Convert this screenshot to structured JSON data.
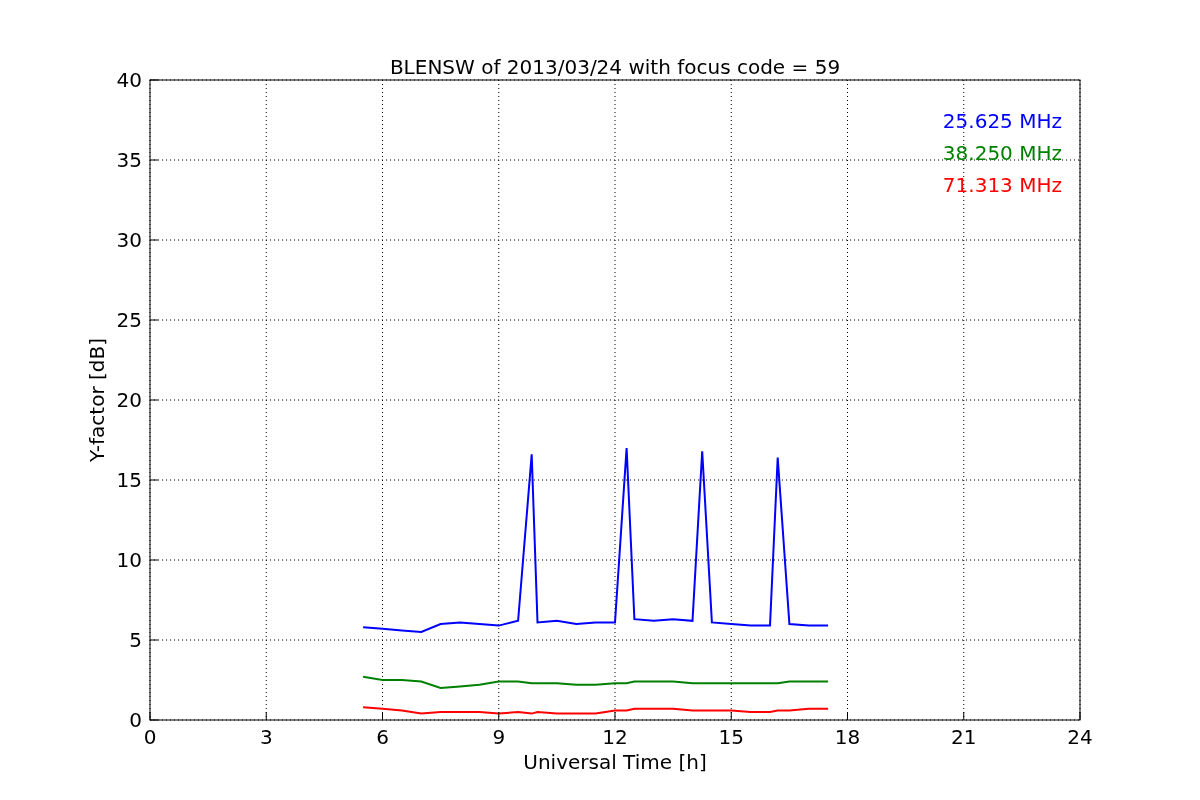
{
  "chart_data": {
    "type": "line",
    "title": "BLENSW of 2013/03/24 with focus code = 59",
    "xlabel": "Universal Time [h]",
    "ylabel": "Y-factor [dB]",
    "x": [
      5.5,
      6,
      6.5,
      7,
      7.5,
      8,
      8.5,
      9,
      9.5,
      9.85,
      10,
      10.5,
      11,
      11.5,
      12,
      12.3,
      12.5,
      13,
      13.5,
      14,
      14.25,
      14.5,
      15,
      15.5,
      16,
      16.2,
      16.5,
      17,
      17.5
    ],
    "series": [
      {
        "name": "25.625 MHz",
        "color": "#0000ff",
        "values": [
          5.8,
          5.7,
          5.6,
          5.5,
          6.0,
          6.1,
          6.0,
          5.9,
          6.2,
          16.6,
          6.1,
          6.2,
          6.0,
          6.1,
          6.1,
          17.0,
          6.3,
          6.2,
          6.3,
          6.2,
          16.8,
          6.1,
          6.0,
          5.9,
          5.9,
          16.4,
          6.0,
          5.9,
          5.9
        ]
      },
      {
        "name": "38.250 MHz",
        "color": "#008000",
        "values": [
          2.7,
          2.5,
          2.5,
          2.4,
          2.0,
          2.1,
          2.2,
          2.4,
          2.4,
          2.3,
          2.3,
          2.3,
          2.2,
          2.2,
          2.3,
          2.3,
          2.4,
          2.4,
          2.4,
          2.3,
          2.3,
          2.3,
          2.3,
          2.3,
          2.3,
          2.3,
          2.4,
          2.4,
          2.4
        ]
      },
      {
        "name": "71.313 MHz",
        "color": "#ff0000",
        "values": [
          0.8,
          0.7,
          0.6,
          0.4,
          0.5,
          0.5,
          0.5,
          0.4,
          0.5,
          0.4,
          0.5,
          0.4,
          0.4,
          0.4,
          0.6,
          0.6,
          0.7,
          0.7,
          0.7,
          0.6,
          0.6,
          0.6,
          0.6,
          0.5,
          0.5,
          0.6,
          0.6,
          0.7,
          0.7
        ]
      }
    ],
    "xlim": [
      0,
      24
    ],
    "ylim": [
      0,
      40
    ],
    "xticks": [
      0,
      3,
      6,
      9,
      12,
      15,
      18,
      21,
      24
    ],
    "yticks": [
      0,
      5,
      10,
      15,
      20,
      25,
      30,
      35,
      40
    ],
    "grid": true
  }
}
